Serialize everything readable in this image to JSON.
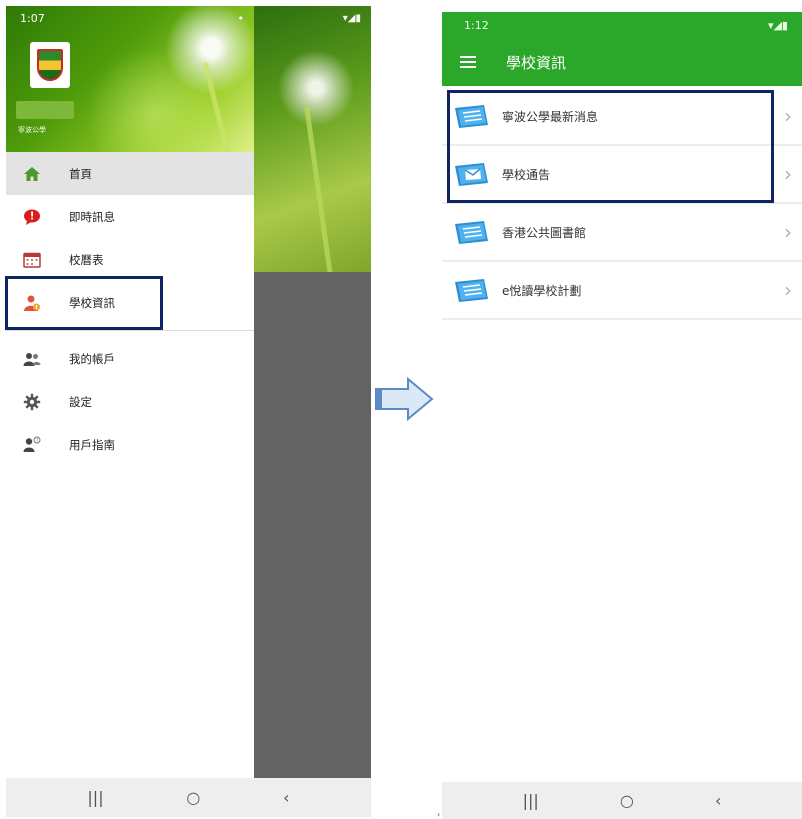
{
  "left_phone": {
    "status_time": "1:07",
    "status_right": "▾◢▮",
    "header": {
      "school_short": "寧波公學"
    },
    "menu": [
      {
        "label": "首頁",
        "icon": "home-icon",
        "active": true
      },
      {
        "label": "即時訊息",
        "icon": "message-icon",
        "active": false
      },
      {
        "label": "校曆表",
        "icon": "calendar-icon",
        "active": false
      },
      {
        "label": "學校資訊",
        "icon": "school-info-icon",
        "active": false
      }
    ],
    "menu2": [
      {
        "label": "我的帳戶",
        "icon": "account-icon"
      },
      {
        "label": "設定",
        "icon": "gear-icon"
      },
      {
        "label": "用戶指南",
        "icon": "user-guide-icon"
      }
    ],
    "navbar": {
      "recent": "|||",
      "home": "○",
      "back": "‹"
    }
  },
  "right_phone": {
    "status_time": "1:12",
    "status_right": "▾◢▮",
    "title": "學校資訊",
    "items": [
      {
        "label": "寧波公學最新消息"
      },
      {
        "label": "學校通告"
      },
      {
        "label": "香港公共圖書館"
      },
      {
        "label": "e悅讀學校計劃"
      }
    ],
    "chevron": "›",
    "navbar": {
      "recent": "|||",
      "home": "○",
      "back": "‹"
    }
  },
  "colors": {
    "app_green": "#2ba829",
    "highlight": "#0f2463",
    "arrow_fill": "#dbe8f6",
    "arrow_stroke": "#5b8ac6"
  }
}
